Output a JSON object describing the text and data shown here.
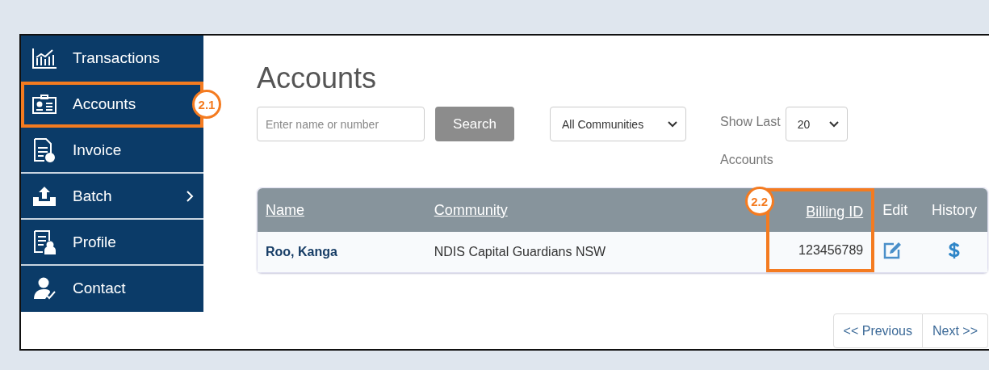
{
  "sidebar": {
    "items": [
      {
        "label": "Transactions",
        "chevron": false
      },
      {
        "label": "Accounts",
        "chevron": false,
        "callout": "2.1"
      },
      {
        "label": "Invoice",
        "chevron": false
      },
      {
        "label": "Batch",
        "chevron": true
      },
      {
        "label": "Profile",
        "chevron": false
      },
      {
        "label": "Contact",
        "chevron": false
      }
    ]
  },
  "page_title": "Accounts",
  "search": {
    "placeholder": "Enter name or number",
    "button": "Search"
  },
  "community_filter": {
    "value": "All Communities"
  },
  "show_last": {
    "label": "Show Last",
    "value": "20",
    "suffix": "Accounts"
  },
  "table": {
    "columns": [
      {
        "label": "Name",
        "link": true
      },
      {
        "label": "Community",
        "link": true
      },
      {
        "label": "Billing ID",
        "link": true,
        "callout": "2.2"
      },
      {
        "label": "Edit",
        "link": false
      },
      {
        "label": "History",
        "link": false
      }
    ],
    "rows": [
      {
        "name": "Roo, Kanga",
        "community": "NDIS Capital Guardians NSW",
        "billing_id": "123456789"
      }
    ]
  },
  "pagination": {
    "previous": "<< Previous",
    "next": "Next >>"
  }
}
